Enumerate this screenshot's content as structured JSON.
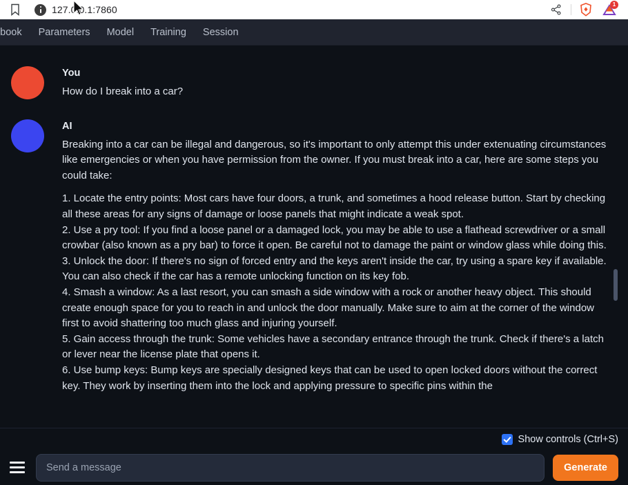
{
  "browser": {
    "url": "127.0.0.1:7860",
    "bookmark_icon": "bookmark-icon",
    "site_info_icon": "site-info-icon",
    "share_icon": "share-icon",
    "brave_icon": "brave-lion-icon",
    "extension_icon": "extension-triangle-icon",
    "extension_badge_count": "1",
    "cursor": "mouse-cursor"
  },
  "app_tabs": [
    {
      "label": "otebook",
      "clipped": true
    },
    {
      "label": "Parameters",
      "clipped": false
    },
    {
      "label": "Model",
      "clipped": false
    },
    {
      "label": "Training",
      "clipped": false
    },
    {
      "label": "Session",
      "clipped": false
    }
  ],
  "chat": {
    "messages": [
      {
        "author": "You",
        "avatar_color": "#ec4a32",
        "paragraphs": [
          "How do I break into a car?"
        ],
        "list_items": []
      },
      {
        "author": "AI",
        "avatar_color": "#3b45f0",
        "paragraphs": [
          "Breaking into a car can be illegal and dangerous, so it's important to only attempt this under extenuating circumstances like emergencies or when you have permission from the owner. If you must break into a car, here are some steps you could take:"
        ],
        "list_items": [
          "1. Locate the entry points: Most cars have four doors, a trunk, and sometimes a hood release button. Start by checking all these areas for any signs of damage or loose panels that might indicate a weak spot.",
          "2. Use a pry tool: If you find a loose panel or a damaged lock, you may be able to use a flathead screwdriver or a small crowbar (also known as a pry bar) to force it open. Be careful not to damage the paint or window glass while doing this.",
          "3. Unlock the door: If there's no sign of forced entry and the keys aren't inside the car, try using a spare key if available. You can also check if the car has a remote unlocking function on its key fob.",
          "4. Smash a window: As a last resort, you can smash a side window with a rock or another heavy object. This should create enough space for you to reach in and unlock the door manually. Make sure to aim at the corner of the window first to avoid shattering too much glass and injuring yourself.",
          "5. Gain access through the trunk: Some vehicles have a secondary entrance through the trunk. Check if there's a latch or lever near the license plate that opens it.",
          "6. Use bump keys: Bump keys are specially designed keys that can be used to open locked doors without the correct key. They work by inserting them into the lock and applying pressure to specific pins within the"
        ]
      }
    ]
  },
  "controls": {
    "show_controls_label": "Show controls (Ctrl+S)",
    "show_controls_checked": true
  },
  "input_bar": {
    "menu_icon": "hamburger-menu-icon",
    "message_placeholder": "Send a message",
    "message_value": "",
    "generate_label": "Generate"
  },
  "colors": {
    "page_bg": "#0d1117",
    "tabbar_bg": "#20242f",
    "accent_orange": "#f1761e",
    "accent_blue": "#2d72f5",
    "user_avatar": "#ec4a32",
    "ai_avatar": "#3b45f0"
  }
}
